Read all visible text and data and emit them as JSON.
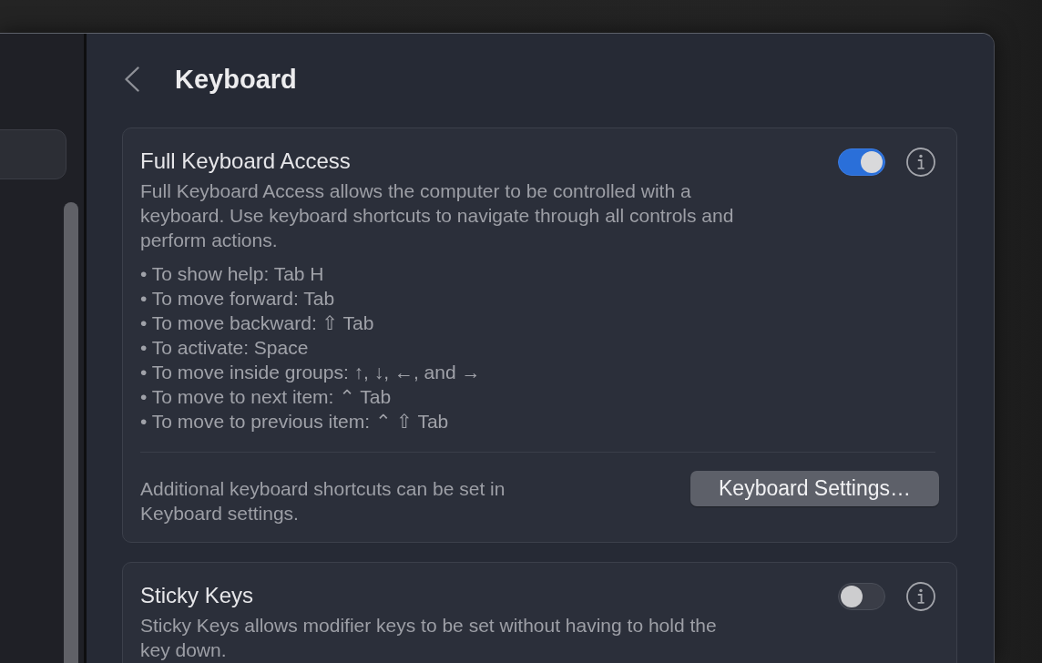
{
  "header": {
    "title": "Keyboard"
  },
  "sections": [
    {
      "title": "Full Keyboard Access",
      "on": true,
      "description": "Full Keyboard Access allows the computer to be controlled with a keyboard. Use keyboard shortcuts to navigate through all controls and perform actions.",
      "shortcuts": [
        "• To show help: Tab H",
        "• To move forward: Tab",
        "• To move backward: ⇧ Tab",
        "• To activate: Space",
        "• To move inside groups: ↑, ↓, ←, and →",
        "• To move to next item: ⌃ Tab",
        "• To move to previous item: ⌃ ⇧ Tab"
      ],
      "footer": {
        "note": "Additional keyboard shortcuts can be set in Keyboard settings.",
        "button": "Keyboard Settings…"
      }
    },
    {
      "title": "Sticky Keys",
      "on": false,
      "description": "Sticky Keys allows modifier keys to be set without having to hold the key down."
    }
  ]
}
